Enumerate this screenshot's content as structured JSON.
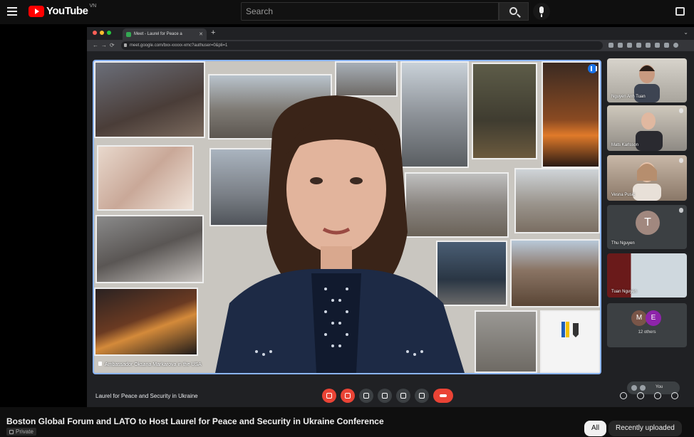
{
  "youtube": {
    "logo_text": "YouTube",
    "region": "VN",
    "search_placeholder": "Search"
  },
  "browser": {
    "tab_title": "Meet - Laurel for Peace a",
    "url": "meet.google.com/bxx-xxxxx-xmc?authuser=0&pli=1"
  },
  "meet": {
    "speaker_name": "Ambassador Oksana Markarova in the USA",
    "participants": [
      {
        "name": "Nguyen Anh Tuan"
      },
      {
        "name": "Mats Karlsson"
      },
      {
        "name": "Vesna Pusic"
      },
      {
        "name": "Thu Nguyen",
        "initial": "T"
      },
      {
        "name": "Tuan Nguyen"
      }
    ],
    "others": {
      "initials": [
        "M",
        "E"
      ],
      "label": "12 others"
    },
    "you_label": "You",
    "meeting_title": "Laurel for Peace and Security in Ukraine"
  },
  "video": {
    "title": "Boston Global Forum and LATO to Host Laurel for Peace and Security in Ukraine Conference",
    "privacy": "Private"
  },
  "chips": {
    "all": "All",
    "recent": "Recently uploaded"
  },
  "colors": {
    "brand_red": "#ff0000",
    "meet_blue": "#8ab4f8",
    "end_call_red": "#ea4335"
  }
}
